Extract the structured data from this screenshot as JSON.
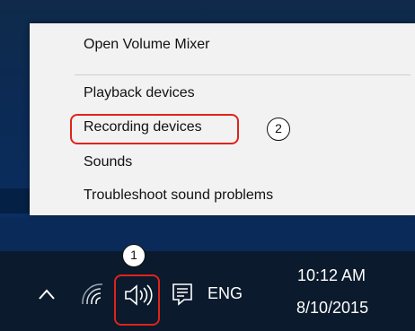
{
  "context_menu": {
    "items": [
      {
        "label": "Open Volume Mixer"
      },
      {
        "label": "Playback devices"
      },
      {
        "label": "Recording devices"
      },
      {
        "label": "Sounds"
      },
      {
        "label": "Troubleshoot sound problems"
      }
    ]
  },
  "annotations": {
    "step_1": "1",
    "step_2": "2",
    "highlight_color": "#e0231a"
  },
  "taskbar": {
    "language": "ENG",
    "time": "10:12 AM",
    "date": "8/10/2015",
    "icons": [
      "chevron-up-icon",
      "wifi-icon",
      "speaker-icon",
      "action-center-icon"
    ]
  }
}
